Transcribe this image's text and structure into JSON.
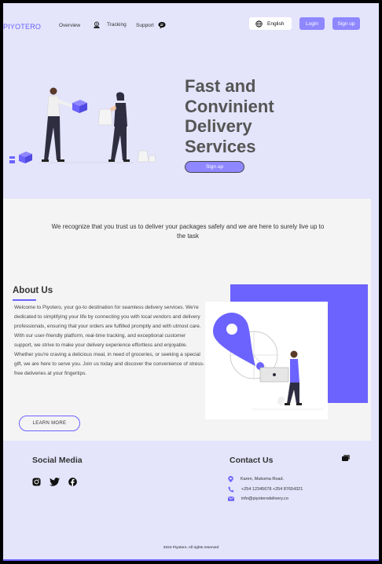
{
  "nav": {
    "logo": "PIYOTERO",
    "links": [
      "Overview",
      "Tracking",
      "Support"
    ],
    "language": "English",
    "login": "Login",
    "signup": "Sign up"
  },
  "hero": {
    "title_lines": [
      "Fast and",
      "Convinient",
      "Delivery",
      "Services"
    ],
    "cta": "Sign up"
  },
  "trust": {
    "text": "We recognize that you trust us to deliver your packages safely and we are here to surely live up to the task"
  },
  "about": {
    "title": "About Us",
    "text": "Welcome to Piyotero, your go-to destination for seamless delivery services. We're dedicated to simplifying your life by connecting you with local vendors and delivery professionals, ensuring that your orders are fulfilled promptly and with utmost care. With our user-friendly platform, real-time tracking, and exceptional customer support, we strive to make your delivery experience effortless and enjoyable. Whether you're craving a delicious meal, in need of groceries, or seeking a special gift, we are here to serve you. Join us today and discover the convenience of stress-free deliveries at your fingertips.",
    "button": "LEARN MORE"
  },
  "footer": {
    "social_title": "Social Media",
    "social_icons": [
      "instagram-icon",
      "twitter-icon",
      "facebook-icon"
    ],
    "contact_title": "Contact Us",
    "address": "Karen, Mukoma Road.",
    "phone": "+254 12345678 +254 87654321",
    "email": "info@piyoterodelivery.co",
    "copyright": "2024 Piyotero. All rights reserved"
  },
  "colors": {
    "accent": "#6c63ff",
    "button": "#8f87ff",
    "background": "#e4e4fb",
    "section": "#f4f4f4"
  }
}
